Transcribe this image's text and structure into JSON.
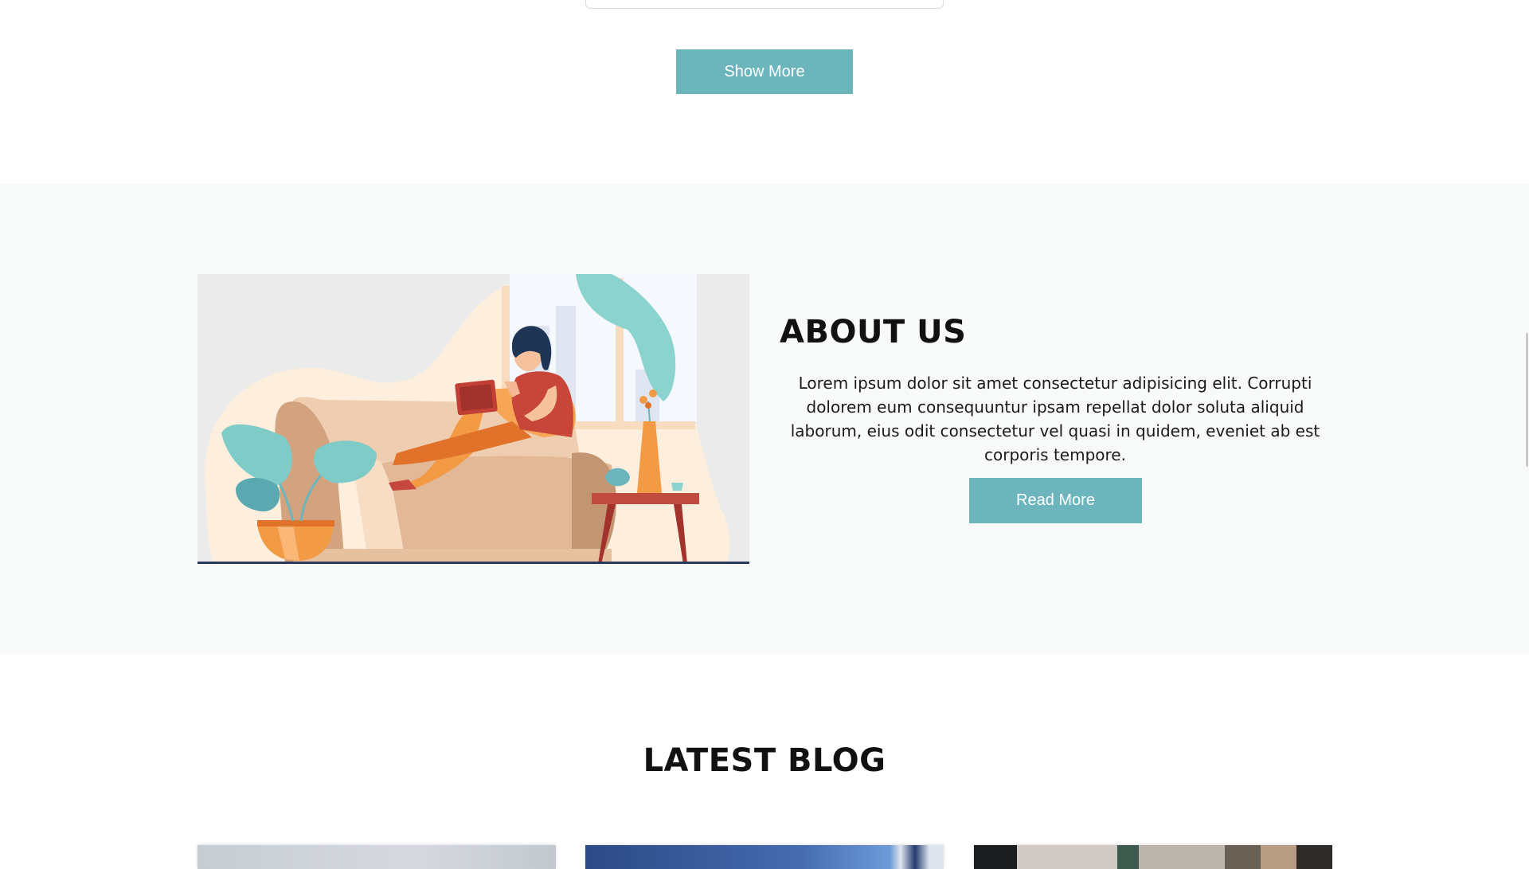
{
  "services": {
    "show_more_label": "Show More"
  },
  "about": {
    "title": "ABOUT US",
    "text": "Lorem ipsum dolor sit amet consectetur adipisicing elit. Corrupti dolorem eum consequuntur ipsam repellat dolor soluta aliquid laborum, eius odit consectetur vel quasi in quidem, eveniet ab est corporis tempore.",
    "read_more_label": "Read More",
    "illustration_icon": "woman-reading-tablet-on-sofa-illustration"
  },
  "blog": {
    "title": "LATEST BLOG"
  },
  "colors": {
    "accent": "#6cb5bc",
    "section_bg": "#f8f9f9",
    "heading": "#111111"
  }
}
